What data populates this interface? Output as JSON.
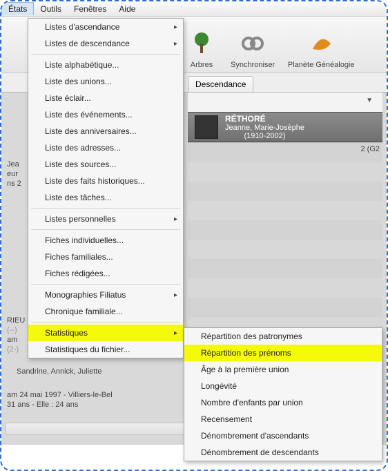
{
  "menubar": {
    "etats": "États",
    "outils": "Outils",
    "fenetres": "Fenêtres",
    "aide": "Aide"
  },
  "toolbar": {
    "arbres": "Arbres",
    "synchroniser": "Synchroniser",
    "planete": "Planète Généalogie"
  },
  "tabs": {
    "descendance": "Descendance"
  },
  "person": {
    "surname": "RÉTHORÉ",
    "given": "Jeanne, Marie-Josèphe",
    "dates": "(1910-2002)"
  },
  "right_badge": "2 (G2",
  "left_block": {
    "line1": "RIEU",
    "line2": "(--)",
    "line3": "am",
    "line4": "(2-)"
  },
  "names_line": "Sandrine, Annick, Juliette",
  "footer1": "am 24 mai 1997 - Villiers-le-Bel",
  "footer2": "31 ans - Elle : 24 ans",
  "left_top": {
    "l1": "Jea",
    "l2": "eur",
    "l3": "ns 2"
  },
  "menu_etats": {
    "ascendance": "Listes d'ascendance",
    "descendance": "Listes de descendance",
    "alphabetique": "Liste alphabétique...",
    "unions": "Liste des unions...",
    "eclair": "Liste éclair...",
    "evenements": "Liste des événements...",
    "anniversaires": "Liste des anniversaires...",
    "adresses": "Liste des adresses...",
    "sources": "Liste des sources...",
    "faits": "Liste des faits historiques...",
    "taches": "Liste des tâches...",
    "personnelles": "Listes personnelles",
    "fiches_ind": "Fiches individuelles...",
    "fiches_fam": "Fiches familiales...",
    "fiches_red": "Fiches rédigées...",
    "monographies": "Monographies Filiatus",
    "chronique": "Chronique familiale...",
    "statistiques": "Statistiques",
    "stat_fichier": "Statistiques du fichier..."
  },
  "submenu_stats": {
    "patronymes": "Répartition des patronymes",
    "prenoms": "Répartition des prénoms",
    "age_union": "Âge à la première union",
    "longevite": "Longévité",
    "enfants": "Nombre d'enfants par union",
    "recensement": "Recensement",
    "denom_asc": "Dénombrement d'ascendants",
    "denom_desc": "Dénombrement de descendants"
  }
}
